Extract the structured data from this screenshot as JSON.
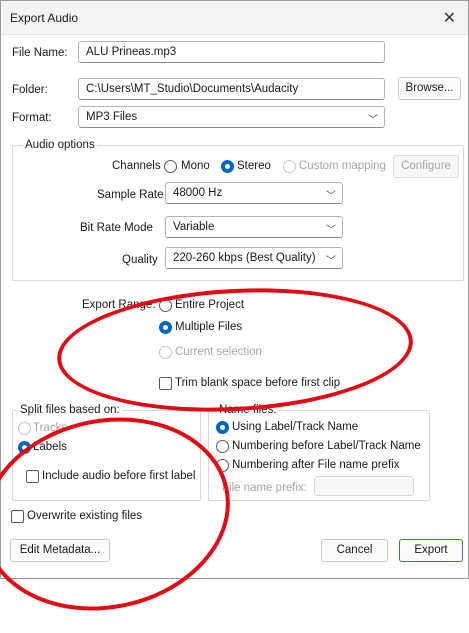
{
  "window": {
    "title": "Export Audio",
    "close_icon": "close-icon"
  },
  "file_name": {
    "label": "File Name:",
    "value": "ALU Prineas.mp3"
  },
  "folder": {
    "label": "Folder:",
    "value": "C:\\Users\\MT_Studio\\Documents\\Audacity",
    "browse_label": "Browse..."
  },
  "format": {
    "label": "Format:",
    "value": "MP3 Files"
  },
  "audio_options": {
    "title": "Audio options",
    "channels": {
      "label": "Channels",
      "mono": "Mono",
      "stereo": "Stereo",
      "custom": "Custom mapping",
      "configure": "Configure",
      "selected": "Stereo"
    },
    "sample_rate": {
      "label": "Sample Rate",
      "value": "48000 Hz"
    },
    "bit_rate_mode": {
      "label": "Bit Rate Mode",
      "value": "Variable"
    },
    "quality": {
      "label": "Quality",
      "value": "220-260 kbps (Best Quality)"
    }
  },
  "export_range": {
    "label": "Export Range:",
    "entire": "Entire Project",
    "multiple": "Multiple Files",
    "current": "Current selection",
    "selected": "Multiple Files",
    "trim_label": "Trim blank space before first clip",
    "trim_checked": false
  },
  "split": {
    "title": "Split files based on:",
    "tracks": "Tracks",
    "labels": "Labels",
    "include_audio": "Include audio before first label",
    "include_checked": false
  },
  "name_files": {
    "title": "Name files:",
    "using_label": "Using Label/Track Name",
    "numbering_before": "Numbering before Label/Track Name",
    "numbering_after": "Numbering after File name prefix",
    "prefix_label": "File name prefix:",
    "prefix_value": "",
    "selected": "Using Label/Track Name"
  },
  "overwrite": {
    "label": "Overwrite existing files",
    "checked": false
  },
  "footer": {
    "edit_metadata": "Edit Metadata...",
    "cancel": "Cancel",
    "export": "Export"
  },
  "annotation_color": "#e50914"
}
